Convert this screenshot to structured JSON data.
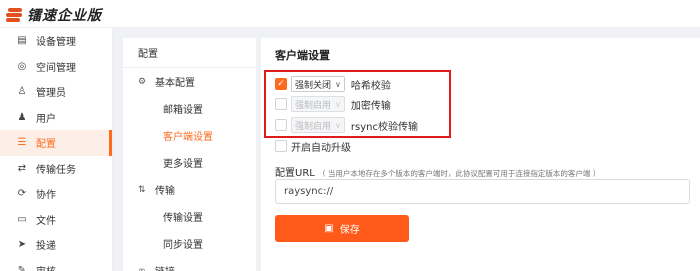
{
  "app": {
    "name": "镭速企业版"
  },
  "sidebar": {
    "items": [
      {
        "label": "设备管理",
        "icon": "device-icon"
      },
      {
        "label": "空间管理",
        "icon": "space-icon"
      },
      {
        "label": "管理员",
        "icon": "admin-icon"
      },
      {
        "label": "用户",
        "icon": "user-icon"
      },
      {
        "label": "配置",
        "icon": "config-icon",
        "active": true
      },
      {
        "label": "传输任务",
        "icon": "transfer-task-icon"
      },
      {
        "label": "协作",
        "icon": "collab-icon"
      },
      {
        "label": "文件",
        "icon": "file-icon"
      },
      {
        "label": "投递",
        "icon": "deliver-icon"
      },
      {
        "label": "审核",
        "icon": "audit-icon"
      }
    ]
  },
  "submenu": {
    "title": "配置",
    "basic": {
      "label": "基本配置",
      "items": [
        "邮箱设置",
        "客户端设置",
        "更多设置"
      ]
    },
    "transfer": {
      "label": "传输",
      "items": [
        "传输设置",
        "同步设置"
      ]
    },
    "next_group": "链接"
  },
  "main": {
    "title": "客户端设置",
    "options": [
      {
        "checked": true,
        "select": "强制关闭",
        "label": "哈希校验",
        "disabled": false
      },
      {
        "checked": false,
        "select": "强制启用",
        "label": "加密传输",
        "disabled": true
      },
      {
        "checked": false,
        "select": "强制启用",
        "label": "rsync校验传输",
        "disabled": true
      }
    ],
    "auto_upgrade": {
      "checked": false,
      "label": "开启自动升级"
    },
    "config_url": {
      "label": "配置URL",
      "hint": "（ 当用户本地存在多个版本的客户端时，此协议配置可用于连接指定版本的客户端 ）",
      "value": "raysync://"
    },
    "save_label": "保存"
  },
  "colors": {
    "accent": "#ff6a1f",
    "highlight_box": "#e01b1b"
  }
}
